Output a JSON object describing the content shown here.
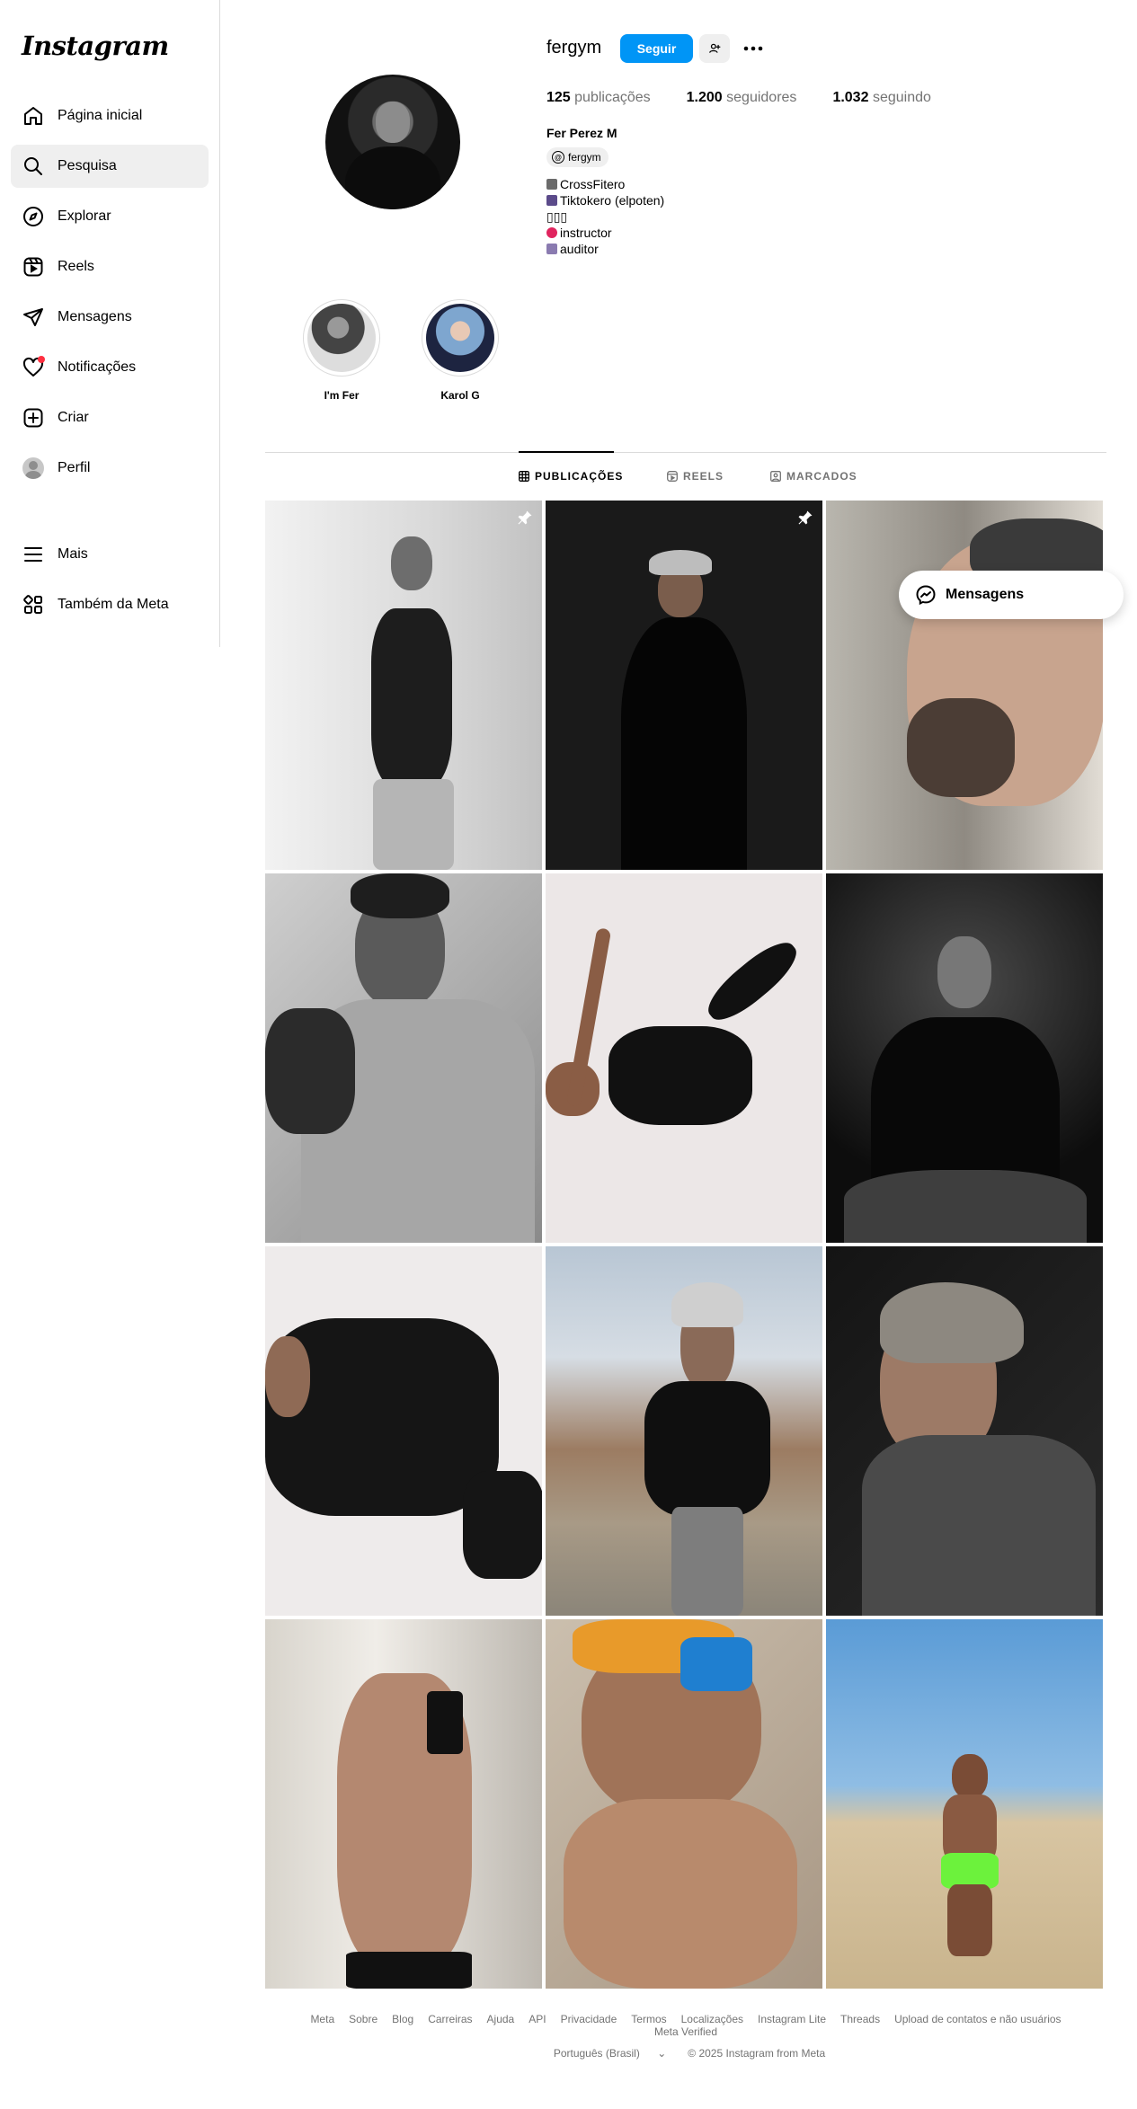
{
  "app": {
    "logo": "Instagram"
  },
  "sidebar": {
    "items": [
      {
        "label": "Página inicial",
        "icon": "home-icon"
      },
      {
        "label": "Pesquisa",
        "icon": "search-icon",
        "active": true
      },
      {
        "label": "Explorar",
        "icon": "compass-icon"
      },
      {
        "label": "Reels",
        "icon": "reels-icon"
      },
      {
        "label": "Mensagens",
        "icon": "send-icon"
      },
      {
        "label": "Notificações",
        "icon": "heart-icon"
      },
      {
        "label": "Criar",
        "icon": "plus-square-icon"
      },
      {
        "label": "Perfil",
        "icon": "avatar"
      },
      {
        "label": "Mais",
        "icon": "menu-icon"
      },
      {
        "label": "Também da Meta",
        "icon": "apps-icon"
      }
    ]
  },
  "profile": {
    "username": "fergym",
    "follow_label": "Seguir",
    "stats": {
      "posts_count": "125",
      "posts_label": "publicações",
      "followers_count": "1.200",
      "followers_label": "seguidores",
      "following_count": "1.032",
      "following_label": "seguindo"
    },
    "full_name": "Fer Perez M",
    "threads_handle": "fergym",
    "bio": [
      "CrossFitero",
      "Tiktokero (elpoten)",
      "▯▯▯",
      " instructor",
      "auditor"
    ]
  },
  "highlights": [
    {
      "label": "I'm Fer"
    },
    {
      "label": "Karol G"
    }
  ],
  "tabs": [
    {
      "label": "PUBLICAÇÕES",
      "active": true
    },
    {
      "label": "REELS"
    },
    {
      "label": "MARCADOS"
    }
  ],
  "floating": {
    "messages_label": "Mensagens"
  },
  "footer": {
    "links": [
      "Meta",
      "Sobre",
      "Blog",
      "Carreiras",
      "Ajuda",
      "API",
      "Privacidade",
      "Termos",
      "Localizações",
      "Instagram Lite",
      "Threads",
      "Upload de contatos e não usuários",
      "Meta Verified"
    ],
    "language": "Português (Brasil)",
    "copyright": "© 2025 Instagram from Meta"
  },
  "colors": {
    "accent": "#0095f6",
    "notification": "#ff3040",
    "muted": "#737373"
  }
}
